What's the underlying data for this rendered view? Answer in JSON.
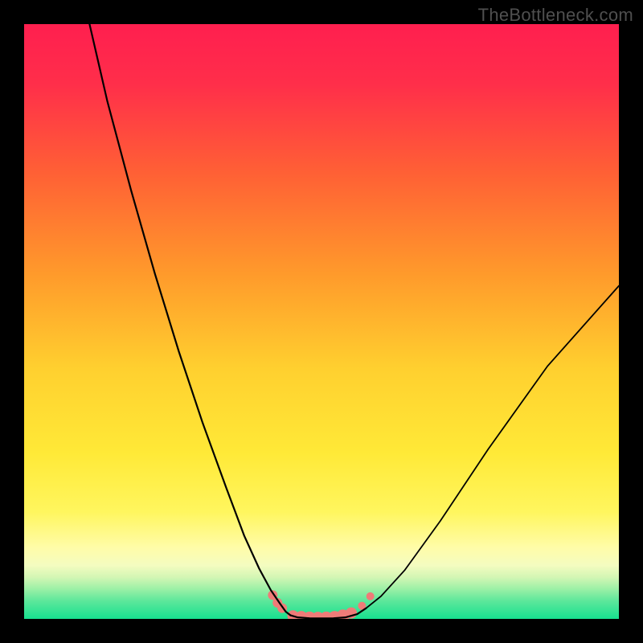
{
  "watermark": "TheBottleneck.com",
  "colors": {
    "top": "#ff1f4f",
    "upper_mid": "#ff7a2e",
    "mid": "#ffe437",
    "low_yellow": "#fff99a",
    "low_green1": "#b8f6a9",
    "low_green2": "#4de39a",
    "bottom_green": "#17e08f",
    "marker": "#ef7b78",
    "curve": "#000000"
  },
  "chart_data": {
    "type": "line",
    "title": "",
    "xlabel": "",
    "ylabel": "",
    "xlim": [
      0,
      100
    ],
    "ylim": [
      0,
      100
    ],
    "series": [
      {
        "name": "left-branch",
        "x": [
          11,
          14,
          18,
          22,
          26,
          30,
          34,
          37,
          39.5,
          41.5,
          43,
          44,
          44.8
        ],
        "y": [
          100,
          87,
          72,
          58,
          45,
          33,
          22,
          14,
          8.5,
          4.8,
          2.6,
          1.2,
          0.6
        ]
      },
      {
        "name": "valley-floor",
        "x": [
          44.8,
          46,
          48,
          50,
          52,
          54,
          56,
          57.5
        ],
        "y": [
          0.6,
          0.25,
          0.1,
          0.08,
          0.1,
          0.25,
          0.8,
          1.8
        ]
      },
      {
        "name": "right-branch",
        "x": [
          57.5,
          60,
          64,
          70,
          78,
          88,
          100
        ],
        "y": [
          1.8,
          3.8,
          8.2,
          16.5,
          28.5,
          42.5,
          56
        ]
      }
    ],
    "markers": {
      "name": "highlighted-points",
      "x": [
        41.8,
        42.6,
        43.4,
        45.2,
        46.6,
        48.0,
        49.4,
        50.8,
        52.2,
        53.6,
        55.0,
        56.8,
        58.2
      ],
      "y": [
        4.0,
        2.7,
        1.8,
        0.5,
        0.25,
        0.15,
        0.12,
        0.15,
        0.25,
        0.5,
        1.0,
        2.2,
        3.8
      ],
      "r": [
        6,
        6,
        6,
        7,
        8,
        8,
        8,
        8,
        8,
        8,
        7,
        5,
        5
      ]
    }
  }
}
